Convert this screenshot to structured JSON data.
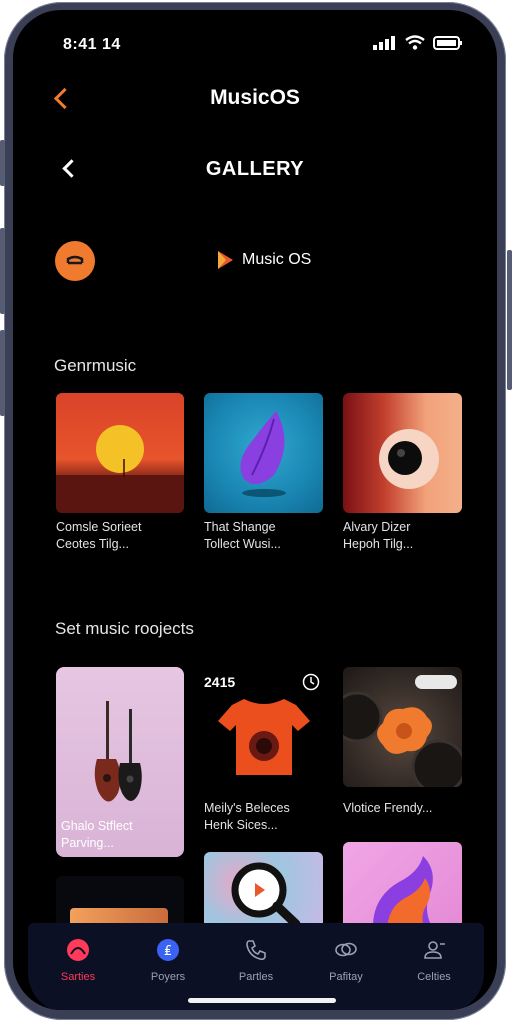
{
  "status": {
    "time": "8:41 14"
  },
  "header": {
    "app_title": "MusicOS"
  },
  "subheader": {
    "title": "GALLERY"
  },
  "brand": {
    "label": "Music OS",
    "accent": "#f07b2e"
  },
  "sections": {
    "genres_title": "Genrmusic",
    "projects_title": "Set music roojects"
  },
  "genres": [
    {
      "caption1": "Comsle Sorieet",
      "caption2": "Ceotes Tilg..."
    },
    {
      "caption1": "That Shange",
      "caption2": "Tollect Wusi..."
    },
    {
      "caption1": "Alvary Dizer",
      "caption2": "Hepoh Tilg..."
    }
  ],
  "projects": {
    "guitar": {
      "caption1": "Ghalo Stflect",
      "caption2": "Parving..."
    },
    "shirt": {
      "badge": "2415",
      "caption1": "Meily's Beleces",
      "caption2": "Henk Sices..."
    },
    "flower": {
      "caption1": "Vlotice Frendy..."
    }
  },
  "tabs": [
    {
      "label": "Sarties",
      "icon": "record-icon",
      "active": true
    },
    {
      "label": "Poyers",
      "icon": "player-icon"
    },
    {
      "label": "Partles",
      "icon": "phone-icon"
    },
    {
      "label": "Pafitay",
      "icon": "chat-icon"
    },
    {
      "label": "Celties",
      "icon": "profile-icon"
    }
  ]
}
